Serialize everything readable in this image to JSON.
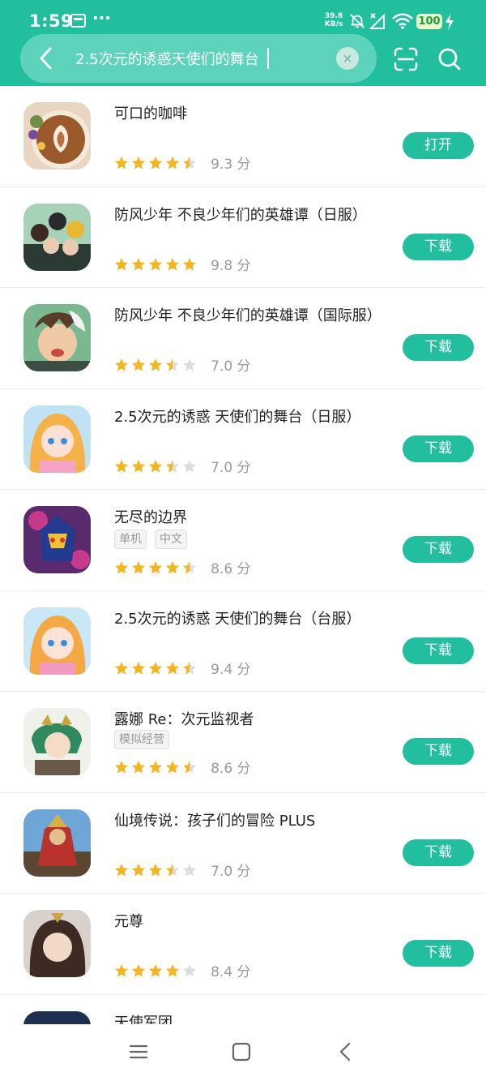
{
  "status_bar": {
    "time": "1:59",
    "speed_value": "39.8",
    "speed_unit": "KB/s",
    "battery": "100",
    "icons": [
      "notification-icon",
      "more-dots-icon",
      "bell-muted-icon",
      "signal-off-icon",
      "wifi-icon",
      "battery-icon",
      "charging-icon"
    ]
  },
  "search": {
    "query": "2.5次元的诱惑天使们的舞台",
    "clear_glyph": "×",
    "icons": [
      "back-arrow-icon",
      "clear-icon",
      "scan-icon",
      "search-icon"
    ]
  },
  "colors": {
    "accent": "#22bf9f",
    "search_pill": "#5dd3bb",
    "star": "#f5b51e",
    "star_empty": "#dcdcdc"
  },
  "apps": [
    {
      "name": "可口的咖啡",
      "tags": [],
      "stars": 4.5,
      "score": "9.3 分",
      "button": "打开"
    },
    {
      "name": "防风少年 不良少年们的英雄谭（日服）",
      "tags": [],
      "stars": 5,
      "score": "9.8 分",
      "button": "下载"
    },
    {
      "name": "防风少年 不良少年们的英雄谭（国际服）",
      "tags": [],
      "stars": 3.5,
      "score": "7.0 分",
      "button": "下载"
    },
    {
      "name": "2.5次元的诱惑 天使们的舞台（日服）",
      "tags": [],
      "stars": 3.5,
      "score": "7.0 分",
      "button": "下载"
    },
    {
      "name": "无尽的边界",
      "tags": [
        "单机",
        "中文"
      ],
      "stars": 4.5,
      "score": "8.6 分",
      "button": "下载"
    },
    {
      "name": "2.5次元的诱惑 天使们的舞台（台服）",
      "tags": [],
      "stars": 4.5,
      "score": "9.4 分",
      "button": "下载"
    },
    {
      "name": "露娜 Re：次元监视者",
      "tags": [
        "模拟经营"
      ],
      "stars": 4.5,
      "score": "8.6 分",
      "button": "下载"
    },
    {
      "name": "仙境传说：孩子们的冒险 PLUS",
      "tags": [],
      "stars": 3.5,
      "score": "7.0 分",
      "button": "下载"
    },
    {
      "name": "元尊",
      "tags": [],
      "stars": 4,
      "score": "8.4 分",
      "button": "下载"
    },
    {
      "name": "天使军团",
      "tags": [],
      "stars": null,
      "score": "",
      "button": ""
    }
  ],
  "nav_icons": [
    "menu-icon",
    "home-icon",
    "back-icon"
  ]
}
